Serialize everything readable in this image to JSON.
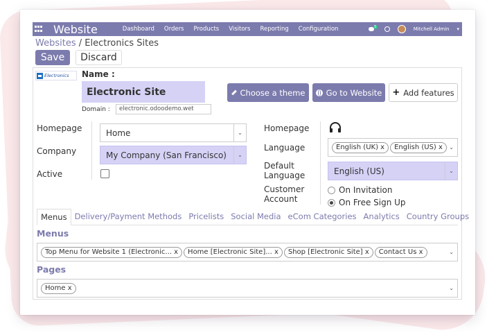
{
  "navbar": {
    "brand": "Website",
    "menu": [
      "Dashboard",
      "Orders",
      "Products",
      "Visitors",
      "Reporting",
      "Configuration"
    ],
    "chat_badge": "5",
    "user": "Mitchell Admin"
  },
  "breadcrumb": {
    "parent": "Websites",
    "separator": " / ",
    "current": "Electronics Sites"
  },
  "actions": {
    "save": "Save",
    "discard": "Discard"
  },
  "logo_text": "Electronics",
  "name_label": "Name :",
  "name_value": "Electronic Site",
  "domain_label": "Domain :",
  "domain_value": "electronic.odoodemo.wet",
  "header_buttons": {
    "choose_theme": "Choose a theme",
    "go_to_website": "Go to Website",
    "add_features": "Add features"
  },
  "left_fields": {
    "homepage_label": "Homepage",
    "homepage_value": "Home",
    "company_label": "Company",
    "company_value": "My Company (San Francisco)",
    "active_label": "Active"
  },
  "right_fields": {
    "homepage_label": "Homepage",
    "language_label": "Language",
    "languages": [
      "English (UK)",
      "English (US)"
    ],
    "default_language_label_1": "Default",
    "default_language_label_2": "Language",
    "default_language_value": "English (US)",
    "customer_account_label_1": "Customer",
    "customer_account_label_2": "Account",
    "options": [
      "On Invitation",
      "On Free Sign Up"
    ],
    "selected_option": "On Free Sign Up"
  },
  "tabs": [
    "Menus",
    "Delivery/Payment Methods",
    "Pricelists",
    "Social Media",
    "eCom Categories",
    "Analytics",
    "Country Groups"
  ],
  "menus_title": "Menus",
  "menus": [
    "Top Menu for Website 1 (Electronic...",
    "Home [Electronic Site]...",
    "Shop [Electronic Site]",
    "Contact Us"
  ],
  "pages_title": "Pages",
  "pages": [
    "Home"
  ],
  "colors": {
    "primary": "#7c7bad",
    "highlight": "#d5d2f6"
  }
}
